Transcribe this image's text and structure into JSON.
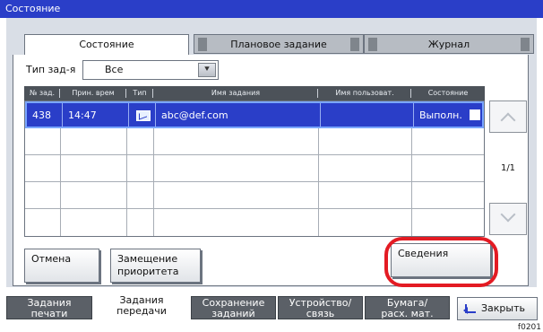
{
  "window": {
    "title": "Состояние"
  },
  "tabs": [
    {
      "label": "Состояние",
      "active": true
    },
    {
      "label": "Плановое задание",
      "active": false
    },
    {
      "label": "Журнал",
      "active": false
    }
  ],
  "filter": {
    "label": "Тип зад-я",
    "value": "Все",
    "arrow_icon": "double-chevron-down-icon"
  },
  "table": {
    "headers": [
      "№ зад.",
      "Прин. врем",
      "Тип",
      "Имя задания",
      "Имя пользоват.",
      "Состояние"
    ],
    "rows": [
      {
        "id": "438",
        "time": "14:47",
        "type_icon": "mail-icon",
        "name": "abc@def.com",
        "user": "",
        "status": "Выполн.",
        "selected": true
      },
      {
        "id": "",
        "time": "",
        "type_icon": "",
        "name": "",
        "user": "",
        "status": "",
        "selected": false
      },
      {
        "id": "",
        "time": "",
        "type_icon": "",
        "name": "",
        "user": "",
        "status": "",
        "selected": false
      },
      {
        "id": "",
        "time": "",
        "type_icon": "",
        "name": "",
        "user": "",
        "status": "",
        "selected": false
      },
      {
        "id": "",
        "time": "",
        "type_icon": "",
        "name": "",
        "user": "",
        "status": "",
        "selected": false
      }
    ],
    "page_indicator": "1/1"
  },
  "buttons": {
    "cancel": "Отмена",
    "priority_line1": "Замещение",
    "priority_line2": "приоритета",
    "details": "Сведения"
  },
  "bottom_tabs": [
    {
      "line1": "Задания",
      "line2": "печати",
      "active": false
    },
    {
      "line1": "Задания",
      "line2": "передачи",
      "active": true
    },
    {
      "line1": "Сохранение",
      "line2": "заданий",
      "active": false
    },
    {
      "line1": "Устройство/",
      "line2": "связь",
      "active": false
    },
    {
      "line1": "Бумага/",
      "line2": "расх. мат.",
      "active": false
    }
  ],
  "close": {
    "label": "Закрыть",
    "icon": "return-arrow-icon"
  },
  "footer_code": "f0201",
  "colors": {
    "accent": "#2a3ec8",
    "highlight": "#e31b23"
  }
}
